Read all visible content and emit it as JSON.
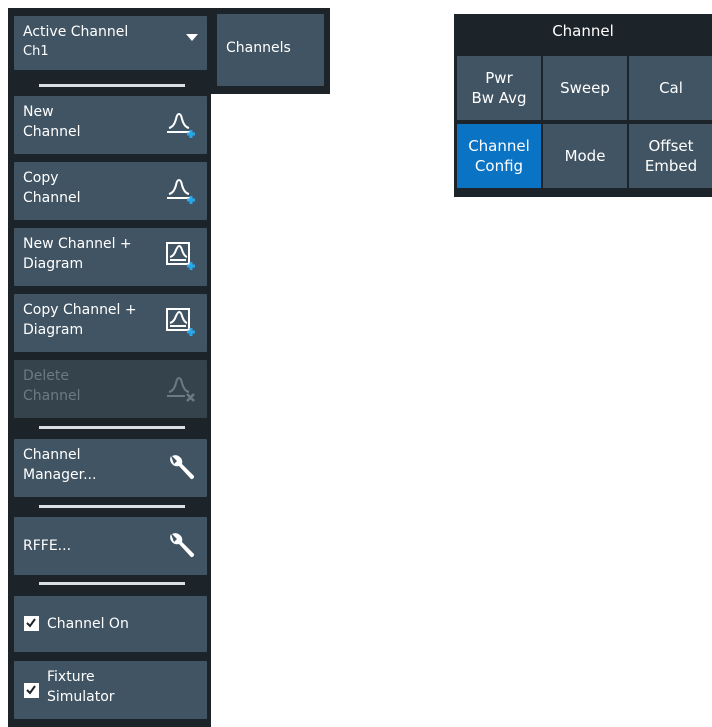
{
  "left_panel": {
    "active_channel": {
      "label": "Active Channel",
      "value": "Ch1"
    },
    "buttons": {
      "new_channel": [
        "New",
        "Channel"
      ],
      "copy_channel": [
        "Copy",
        "Channel"
      ],
      "new_channel_diagram": [
        "New Channel +",
        "Diagram"
      ],
      "copy_channel_diagram": [
        "Copy Channel +",
        "Diagram"
      ],
      "delete_channel": [
        "Delete",
        "Channel"
      ],
      "channel_manager": [
        "Channel",
        "Manager..."
      ],
      "rffe": "RFFE...",
      "channel_on": "Channel On",
      "fixture_simulator": [
        "Fixture",
        "Simulator"
      ]
    },
    "checks": {
      "channel_on": true,
      "fixture_simulator": true
    }
  },
  "tab": {
    "label": "Channels"
  },
  "menu": {
    "title": "Channel",
    "cells": [
      {
        "label": "Pwr\nBw Avg",
        "active": false
      },
      {
        "label": "Sweep",
        "active": false
      },
      {
        "label": "Cal",
        "active": false
      },
      {
        "label": "Channel\nConfig",
        "active": true
      },
      {
        "label": "Mode",
        "active": false
      },
      {
        "label": "Offset\nEmbed",
        "active": false
      }
    ]
  },
  "colors": {
    "panel_bg": "#1d2429",
    "button_bg": "#415463",
    "active_cell": "#0a73c4",
    "plus_accent": "#2aa7e8",
    "disabled_text": "#6b7a85"
  }
}
